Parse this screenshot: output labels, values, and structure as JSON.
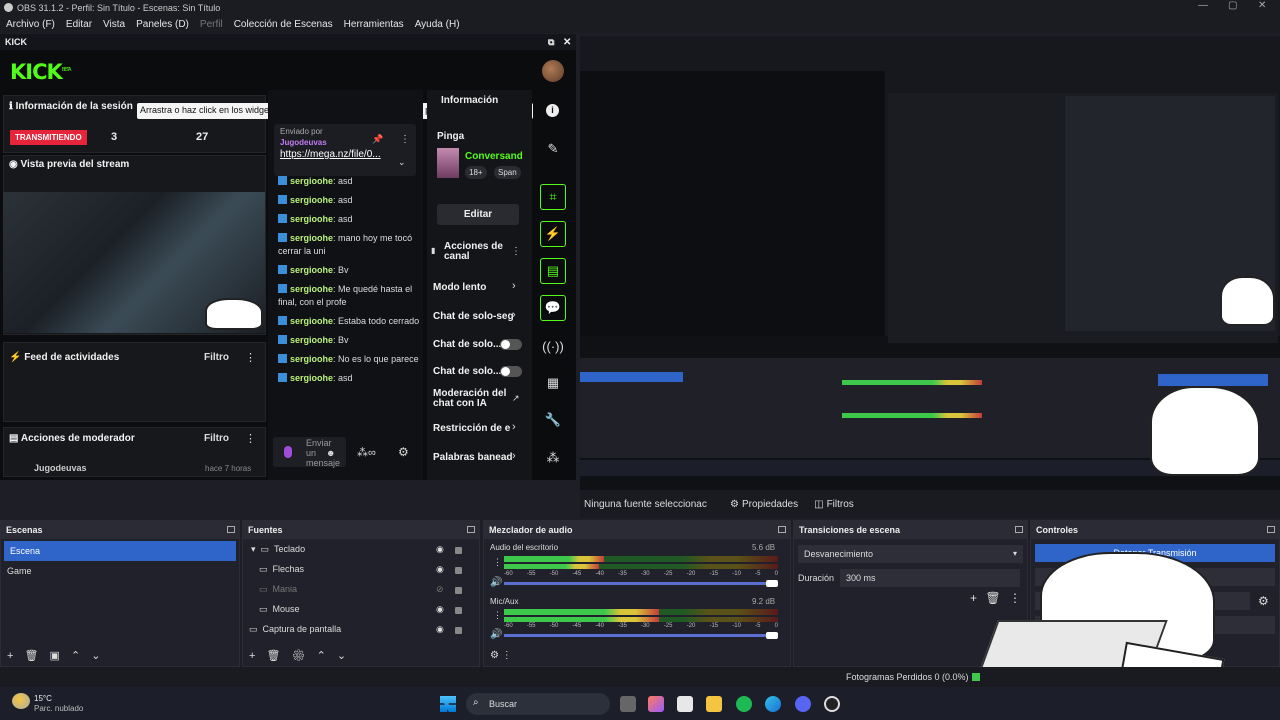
{
  "window": {
    "title": "OBS 31.1.2 - Perfil: Sin Título - Escenas: Sin Título"
  },
  "menu": {
    "items": [
      "Archivo (F)",
      "Editar",
      "Vista",
      "Paneles (D)",
      "Perfil",
      "Colección de Escenas",
      "Herramientas",
      "Ayuda (H)"
    ]
  },
  "kick_dock": {
    "title": "KICK",
    "logo": "KICK",
    "logo_badge": "BETA",
    "session_info": "Información de la sesión",
    "info_overflow": "Información",
    "tooltip": "Arrastra o haz click en los widgets de abajo para personalizar tu propio panel de control",
    "live_badge": "TRANSMITIENDO",
    "stat1": "3",
    "stat2": "27",
    "stream_preview": "Vista previa del stream",
    "activity_feed": "Feed de actividades",
    "filter": "Filtro",
    "mod_actions": "Acciones de moderador",
    "mod_user": "Jugodeuvas",
    "mod_time": "hace 7 horas",
    "pinned": {
      "label": "Enviado por",
      "user": "Jugodeuvas",
      "link": "https://mega.nz/file/0..."
    },
    "chat": [
      {
        "user": "sergioohe",
        "text": "asd"
      },
      {
        "user": "sergioohe",
        "text": "asd"
      },
      {
        "user": "sergioohe",
        "text": "asd"
      },
      {
        "user": "sergioohe",
        "text": "mano hoy me tocó cerrar la uni"
      },
      {
        "user": "sergioohe",
        "text": "Bv"
      },
      {
        "user": "sergioohe",
        "text": "Me quedé hasta el final, con el profe"
      },
      {
        "user": "sergioohe",
        "text": "Estaba todo cerrado"
      },
      {
        "user": "sergioohe",
        "text": "Bv"
      },
      {
        "user": "sergioohe",
        "text": "No es lo que parece"
      },
      {
        "user": "sergioohe",
        "text": "asd"
      }
    ],
    "chat_input_placeholder": "Enviar un mensaje",
    "stream_card": {
      "title": "Pinga",
      "category": "Conversand",
      "age": "18+",
      "lang": "Span",
      "edit": "Editar"
    },
    "channel_actions": {
      "title": "Acciones de canal",
      "items": [
        "Modo lento",
        "Chat de solo-seg",
        "Chat de solo...",
        "Chat de solo...",
        "Moderación del chat con IA",
        "Restricción de e",
        "Palabras banead"
      ]
    }
  },
  "preview_status": {
    "no_source": "Ninguna fuente seleccionac",
    "properties": "Propiedades",
    "filters": "Filtros"
  },
  "scenes": {
    "title": "Escenas",
    "items": [
      "Escena",
      "Game"
    ]
  },
  "sources": {
    "title": "Fuentes",
    "items": [
      {
        "name": "Teclado",
        "group": true
      },
      {
        "name": "Flechas"
      },
      {
        "name": "Mania",
        "hidden": true
      },
      {
        "name": "Mouse"
      },
      {
        "name": "Captura de pantalla",
        "group": false
      }
    ]
  },
  "mixer": {
    "title": "Mezclador de audio",
    "channels": [
      {
        "name": "Audio del escritorio",
        "db": "5.6 dB"
      },
      {
        "name": "Mic/Aux",
        "db": "9.2 dB"
      }
    ],
    "scale": [
      "-60",
      "-55",
      "-50",
      "-45",
      "-40",
      "-35",
      "-30",
      "-25",
      "-20",
      "-15",
      "-10",
      "-5",
      "0"
    ]
  },
  "transitions": {
    "title": "Transiciones de escena",
    "type": "Desvanecimiento",
    "duration_label": "Duración",
    "duration": "300 ms"
  },
  "controls": {
    "title": "Controles",
    "stop_stream": "Detener Transmisión",
    "second": "ción"
  },
  "statusbar": {
    "dropped": "Fotogramas Perdidos 0 (0.0%)"
  },
  "taskbar": {
    "temp": "15°C",
    "weather": "Parc. nublado",
    "search": "Buscar"
  },
  "colors": {
    "kick_green": "#53fc18",
    "live_red": "#e6243a",
    "selection_blue": "#2f64c8"
  }
}
